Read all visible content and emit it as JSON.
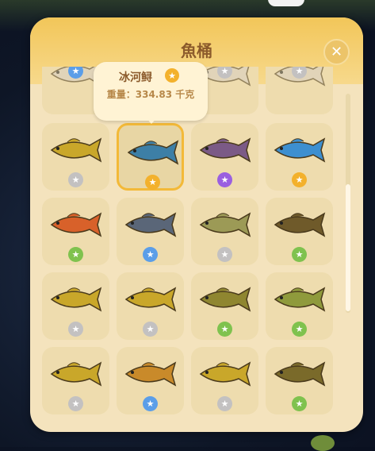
{
  "window": {
    "title": "魚桶",
    "close_icon": "close-icon"
  },
  "tooltip": {
    "name": "冰河鲟",
    "rarity": "gold",
    "weight_text": "重量：334.83 千克"
  },
  "colors": {
    "gold": "#f3b12c",
    "blue": "#5b9ee8",
    "green": "#7fc24e",
    "purple": "#9a5fe0",
    "gray": "#c3c1c1",
    "panel": "#f4e3bd",
    "header": "#f2c659",
    "title": "#8b5a2b"
  },
  "fish": [
    {
      "id": "f1",
      "rarity": "blue",
      "body": "#d8cfc2",
      "partial": true
    },
    {
      "id": "f2",
      "rarity": "gray",
      "body": "#d8cfc2",
      "partial": true
    },
    {
      "id": "f3",
      "rarity": "gray",
      "body": "#d8cfc2",
      "partial": true
    },
    {
      "id": "f4",
      "rarity": "gray",
      "body": "#c9a72a"
    },
    {
      "id": "f5",
      "rarity": "gold",
      "body": "#3d7fa6",
      "selected": true
    },
    {
      "id": "f6",
      "rarity": "purple",
      "body": "#7b5a86"
    },
    {
      "id": "f7",
      "rarity": "gold",
      "body": "#3d8fd0"
    },
    {
      "id": "f8",
      "rarity": "green",
      "body": "#d8612a"
    },
    {
      "id": "f9",
      "rarity": "blue",
      "body": "#5a6678"
    },
    {
      "id": "f10",
      "rarity": "gray",
      "body": "#9c9a56"
    },
    {
      "id": "f11",
      "rarity": "green",
      "body": "#6f5a2a"
    },
    {
      "id": "f12",
      "rarity": "gray",
      "body": "#c9a72a"
    },
    {
      "id": "f13",
      "rarity": "gray",
      "body": "#c9a72a"
    },
    {
      "id": "f14",
      "rarity": "green",
      "body": "#8f8630"
    },
    {
      "id": "f15",
      "rarity": "green",
      "body": "#8f9a3c"
    },
    {
      "id": "f16",
      "rarity": "gray",
      "body": "#c9a72a"
    },
    {
      "id": "f17",
      "rarity": "blue",
      "body": "#c98a2a"
    },
    {
      "id": "f18",
      "rarity": "gray",
      "body": "#c9a72a"
    },
    {
      "id": "f19",
      "rarity": "green",
      "body": "#7a6a2a"
    }
  ]
}
